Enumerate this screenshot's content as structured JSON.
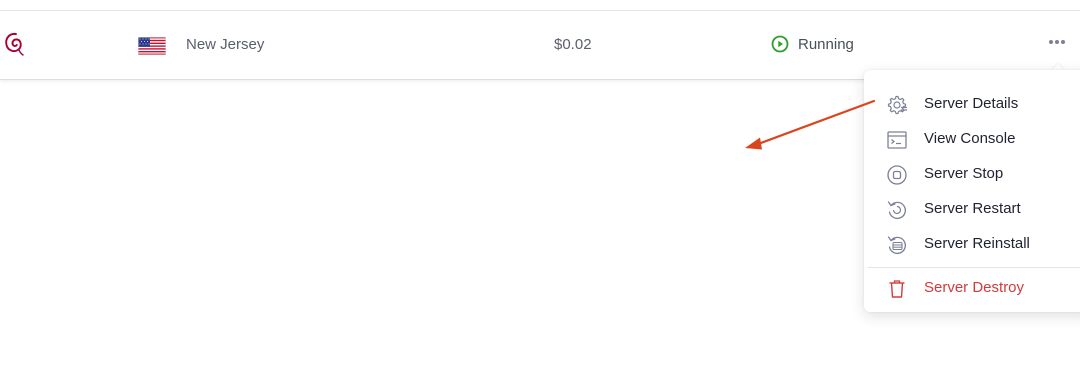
{
  "server_row": {
    "os_icon": "debian-logo",
    "flag_icon": "us-flag-icon",
    "location": "New Jersey",
    "price": "$0.02",
    "status": "Running",
    "status_icon": "play-circle-icon",
    "status_color": "#2e9e2e",
    "more_icon": "more-horizontal-icon"
  },
  "menu": {
    "items": [
      {
        "label": "Server Details",
        "icon": "gear-settings-icon"
      },
      {
        "label": "View Console",
        "icon": "console-icon"
      },
      {
        "label": "Server Stop",
        "icon": "stop-icon"
      },
      {
        "label": "Server Restart",
        "icon": "restart-icon"
      },
      {
        "label": "Server Reinstall",
        "icon": "reinstall-icon"
      }
    ],
    "danger_item": {
      "label": "Server Destroy",
      "icon": "trash-icon",
      "color": "#d33b3b"
    }
  },
  "colors": {
    "annotation_arrow": "#d9451f",
    "icon_gray": "#7d8194",
    "debian_red": "#a80030"
  }
}
